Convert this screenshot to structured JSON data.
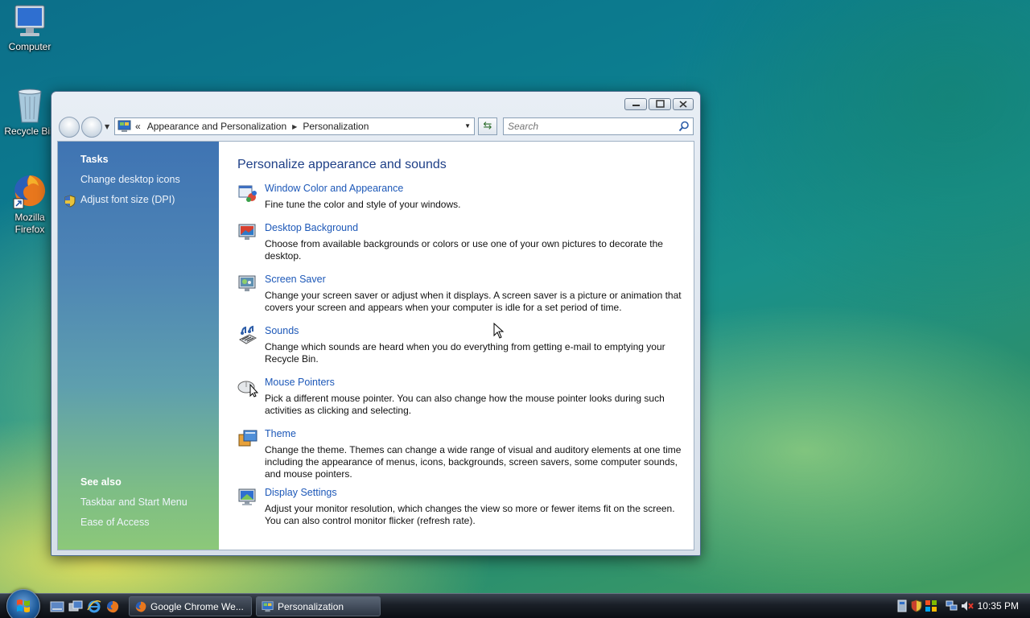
{
  "desktop": {
    "icons": [
      {
        "label": "Computer"
      },
      {
        "label": "Recycle Bin"
      },
      {
        "label": "Mozilla Firefox"
      }
    ]
  },
  "window": {
    "address": {
      "overflow": "«",
      "segments": [
        "Appearance and Personalization",
        "Personalization"
      ]
    },
    "search_placeholder": "Search"
  },
  "sidebar": {
    "tasks_heading": "Tasks",
    "tasks": [
      "Change desktop icons",
      "Adjust font size (DPI)"
    ],
    "see_also_heading": "See also",
    "see_also": [
      "Taskbar and Start Menu",
      "Ease of Access"
    ]
  },
  "main": {
    "heading": "Personalize appearance and sounds",
    "items": [
      {
        "title": "Window Color and Appearance",
        "desc": "Fine tune the color and style of your windows.",
        "icon": "window-color-icon"
      },
      {
        "title": "Desktop Background",
        "desc": "Choose from available backgrounds or colors or use one of your own pictures to decorate the desktop.",
        "icon": "desktop-background-icon"
      },
      {
        "title": "Screen Saver",
        "desc": "Change your screen saver or adjust when it displays. A screen saver is a picture or animation that covers your screen and appears when your computer is idle for a set period of time.",
        "icon": "screen-saver-icon"
      },
      {
        "title": "Sounds",
        "desc": "Change which sounds are heard when you do everything from getting e-mail to emptying your Recycle Bin.",
        "icon": "sounds-icon"
      },
      {
        "title": "Mouse Pointers",
        "desc": "Pick a different mouse pointer. You can also change how the mouse pointer looks during such activities as clicking and selecting.",
        "icon": "mouse-pointer-icon"
      },
      {
        "title": "Theme",
        "desc": "Change the theme. Themes can change a wide range of visual and auditory elements at one time including the appearance of menus, icons, backgrounds, screen savers, some computer sounds, and mouse pointers.",
        "icon": "theme-icon"
      },
      {
        "title": "Display Settings",
        "desc": "Adjust your monitor resolution, which changes the view so more or fewer items fit on the screen. You can also control monitor flicker (refresh rate).",
        "icon": "display-settings-icon"
      }
    ]
  },
  "taskbar": {
    "tasks": [
      {
        "label": "Google Chrome We..."
      },
      {
        "label": "Personalization"
      }
    ],
    "clock": "10:35 PM"
  },
  "colors": {
    "link": "#1d58b8",
    "heading": "#1e3f87",
    "sidebar_top": "#3f74b3",
    "sidebar_bottom": "#8cc879"
  }
}
